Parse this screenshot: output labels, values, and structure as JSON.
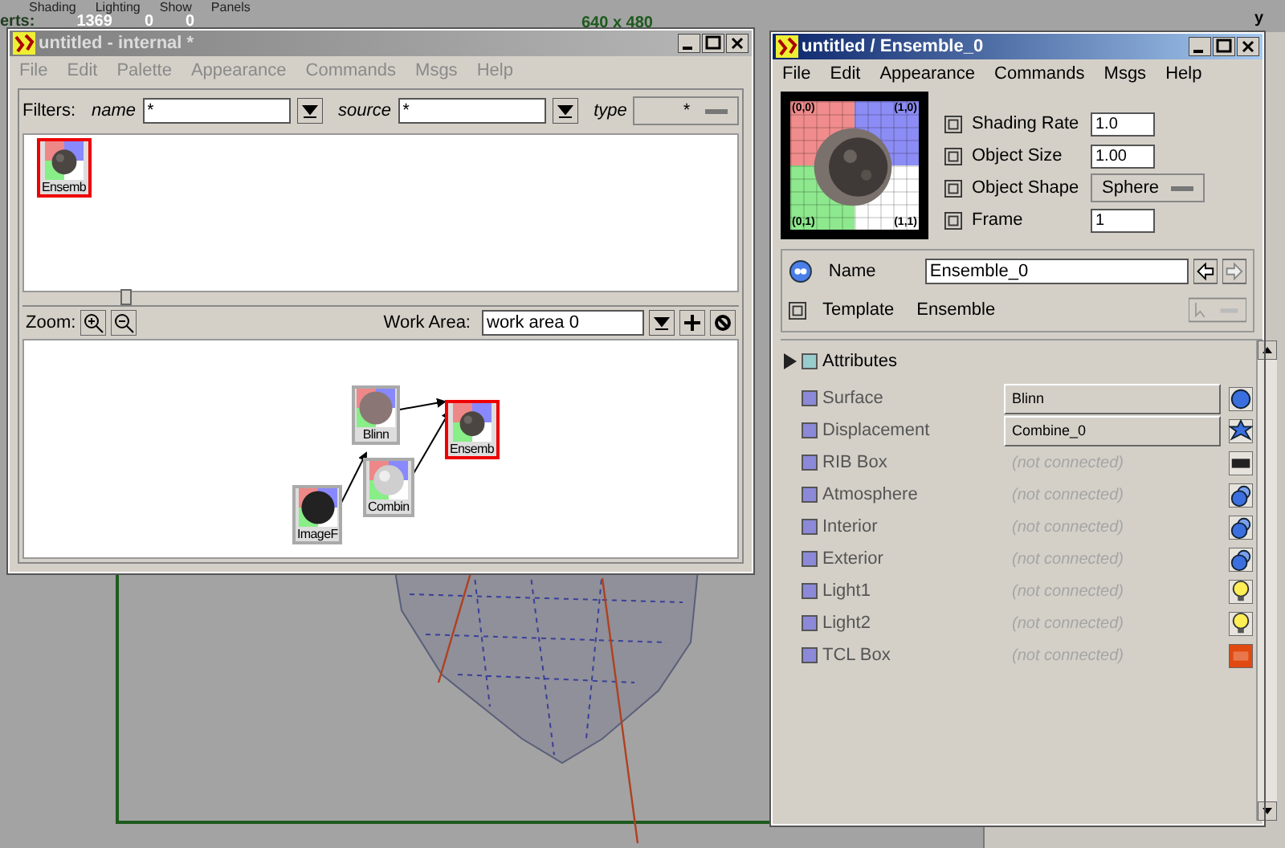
{
  "viewport": {
    "menu": [
      "Shading",
      "Lighting",
      "Show",
      "Panels"
    ],
    "stats_label": "erts:",
    "stats": [
      "1369",
      "0",
      "0"
    ],
    "resolution": "640 x 480",
    "axis_label": "y"
  },
  "library_window": {
    "title": "untitled - internal *",
    "active": false,
    "menu": [
      "File",
      "Edit",
      "Palette",
      "Appearance",
      "Commands",
      "Msgs",
      "Help"
    ],
    "filters": {
      "label": "Filters:",
      "name_label": "name",
      "name_value": "*",
      "source_label": "source",
      "source_value": "*",
      "type_label": "type",
      "type_value": "*"
    },
    "shelf_items": [
      {
        "label": "Ensemb",
        "kind": "rock",
        "selected": true
      }
    ],
    "zoom_label": "Zoom:",
    "work_area_label": "Work Area:",
    "work_area_value": "work area 0",
    "nodes": [
      {
        "label": "Blinn",
        "kind": "sphere",
        "selected": false
      },
      {
        "label": "Ensemb",
        "kind": "rock",
        "selected": true
      },
      {
        "label": "Combin",
        "kind": "marble",
        "selected": false
      },
      {
        "label": "ImageF",
        "kind": "dark",
        "selected": false
      }
    ]
  },
  "editor_window": {
    "title": "untitled / Ensemble_0",
    "active": true,
    "menu": [
      "File",
      "Edit",
      "Appearance",
      "Commands",
      "Msgs",
      "Help"
    ],
    "preview_corners": [
      "(0,0)",
      "(1,0)",
      "(0,1)",
      "(1,1)"
    ],
    "params": [
      {
        "label": "Shading Rate",
        "kind": "field",
        "value": "1.0"
      },
      {
        "label": "Object Size",
        "kind": "field",
        "value": "1.00"
      },
      {
        "label": "Object Shape",
        "kind": "dropdown",
        "value": "Sphere"
      },
      {
        "label": "Frame",
        "kind": "field",
        "value": "1"
      }
    ],
    "name_label": "Name",
    "name_value": "Ensemble_0",
    "template_label": "Template",
    "template_value": "Ensemble",
    "attributes_label": "Attributes",
    "attributes": [
      {
        "label": "Surface",
        "value": "Blinn",
        "connected": true,
        "kind": "surface"
      },
      {
        "label": "Displacement",
        "value": "Combine_0",
        "connected": true,
        "kind": "displacement"
      },
      {
        "label": "RIB Box",
        "value": "(not connected)",
        "connected": false,
        "kind": "rib"
      },
      {
        "label": "Atmosphere",
        "value": "(not connected)",
        "connected": false,
        "kind": "volume"
      },
      {
        "label": "Interior",
        "value": "(not connected)",
        "connected": false,
        "kind": "volume"
      },
      {
        "label": "Exterior",
        "value": "(not connected)",
        "connected": false,
        "kind": "volume"
      },
      {
        "label": "Light1",
        "value": "(not connected)",
        "connected": false,
        "kind": "light"
      },
      {
        "label": "Light2",
        "value": "(not connected)",
        "connected": false,
        "kind": "light"
      },
      {
        "label": "TCL Box",
        "value": "(not connected)",
        "connected": false,
        "kind": "tcl"
      }
    ]
  }
}
